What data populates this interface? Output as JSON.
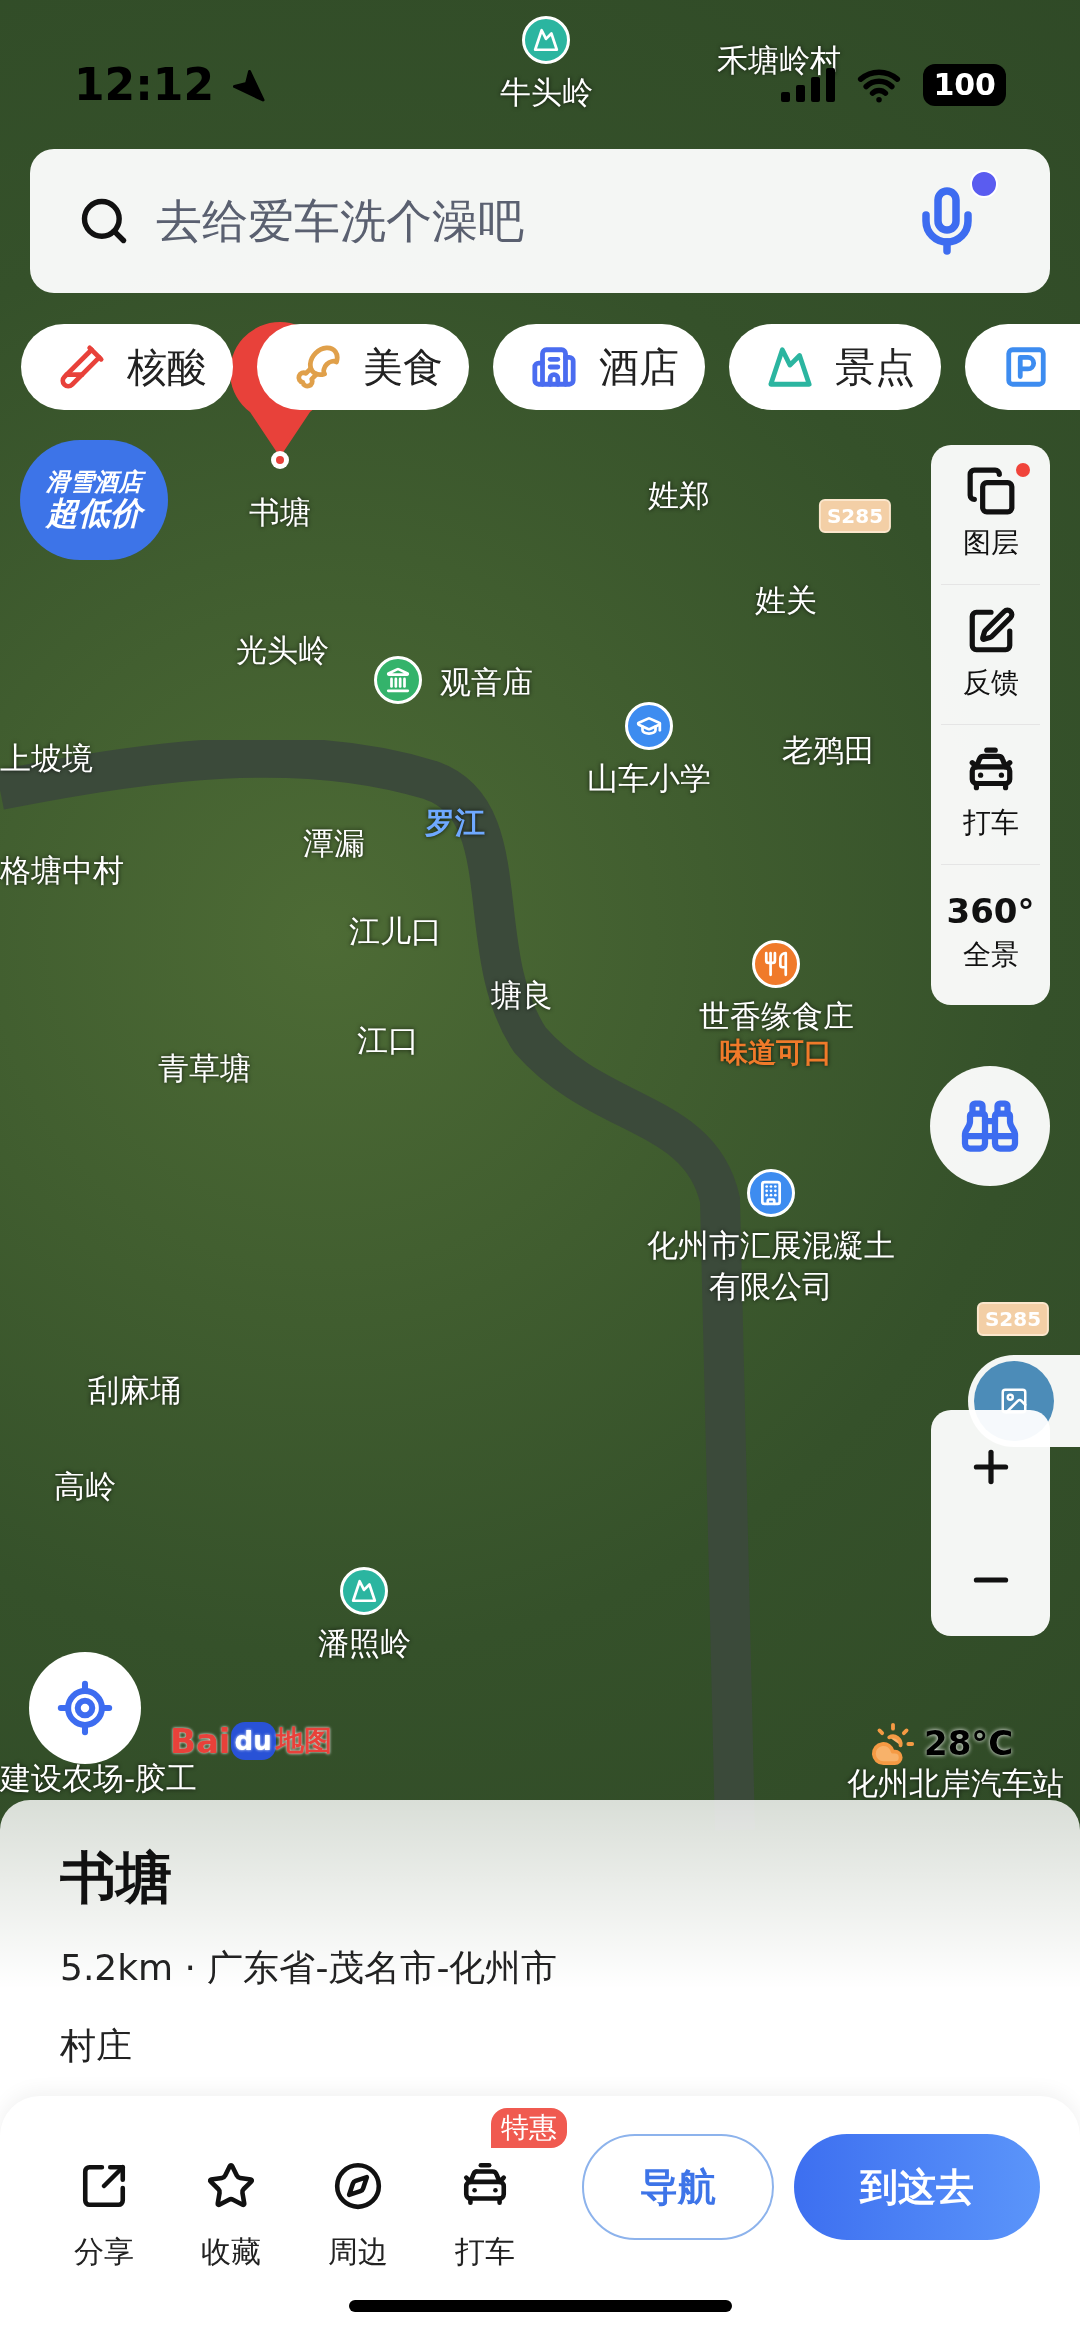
{
  "status_bar": {
    "time": "12:12",
    "battery": "100"
  },
  "search": {
    "placeholder": "去给爱车洗个澡吧",
    "mic_alert": true
  },
  "chips": [
    {
      "label": "核酸",
      "kind": "test"
    },
    {
      "label": "美食",
      "kind": "food"
    },
    {
      "label": "酒店",
      "kind": "hotel"
    },
    {
      "label": "景点",
      "kind": "scenic"
    },
    {
      "kind": "parking"
    }
  ],
  "map_labels": [
    {
      "text": "禾塘岭村",
      "kind": "place"
    },
    {
      "text": "牛头岭",
      "kind": "mountain"
    },
    {
      "text": "书塘",
      "kind": "selected"
    },
    {
      "text": "姓郑",
      "kind": "place"
    },
    {
      "text": "S285",
      "kind": "road"
    },
    {
      "text": "姓关",
      "kind": "place"
    },
    {
      "text": "光头岭",
      "kind": "place"
    },
    {
      "text": "观音庙",
      "kind": "temple"
    },
    {
      "text": "上坡境",
      "kind": "place"
    },
    {
      "text": "老鸦田",
      "kind": "place"
    },
    {
      "text": "山车小学",
      "kind": "school"
    },
    {
      "text": "罗江",
      "kind": "river"
    },
    {
      "text": "潭漏",
      "kind": "place"
    },
    {
      "text": "格塘中村",
      "kind": "place"
    },
    {
      "text": "江儿口",
      "kind": "place"
    },
    {
      "text": "塘良",
      "kind": "place"
    },
    {
      "text": "世香缘食庄",
      "kind": "food"
    },
    {
      "text": "味道可口",
      "kind": "tagline"
    },
    {
      "text": "江口",
      "kind": "place"
    },
    {
      "text": "青草塘",
      "kind": "place"
    },
    {
      "text": "化州市汇展混凝土",
      "kind": "company"
    },
    {
      "text": "有限公司",
      "kind": "place"
    },
    {
      "text": "S285",
      "kind": "road"
    },
    {
      "text": "刮麻埇",
      "kind": "place"
    },
    {
      "text": "高岭",
      "kind": "place"
    },
    {
      "text": "潘照岭",
      "kind": "mountain"
    },
    {
      "text": "建设农场-胶工",
      "kind": "place"
    },
    {
      "text": "化州北岸汽车站",
      "kind": "place"
    }
  ],
  "promo": {
    "lines": [
      "滑雪酒店",
      "超低价"
    ]
  },
  "side_tools": [
    {
      "label": "图层",
      "kind": "layers",
      "alert": true
    },
    {
      "label": "反馈",
      "kind": "feedback",
      "alert": false
    },
    {
      "label": "打车",
      "kind": "taxi",
      "alert": false
    },
    {
      "label": "全景",
      "kind": "panorama",
      "icon_text": "360°",
      "alert": false
    }
  ],
  "peek_item": {
    "kind": "thumbnail"
  },
  "weather": {
    "temperature": "28°C"
  },
  "logo": {
    "parts": [
      "Bai",
      "du",
      "地图"
    ]
  },
  "place": {
    "name": "书塘",
    "details": "5.2km · 广东省-茂名市-化州市",
    "category": "村庄"
  },
  "actions": [
    {
      "label": "分享",
      "kind": "share"
    },
    {
      "label": "收藏",
      "kind": "favorite"
    },
    {
      "label": "周边",
      "kind": "nearby"
    },
    {
      "label": "打车",
      "kind": "taxi",
      "badge": "特惠"
    }
  ],
  "nav_button": {
    "label": "导航"
  },
  "go_button": {
    "label": "到这去"
  }
}
